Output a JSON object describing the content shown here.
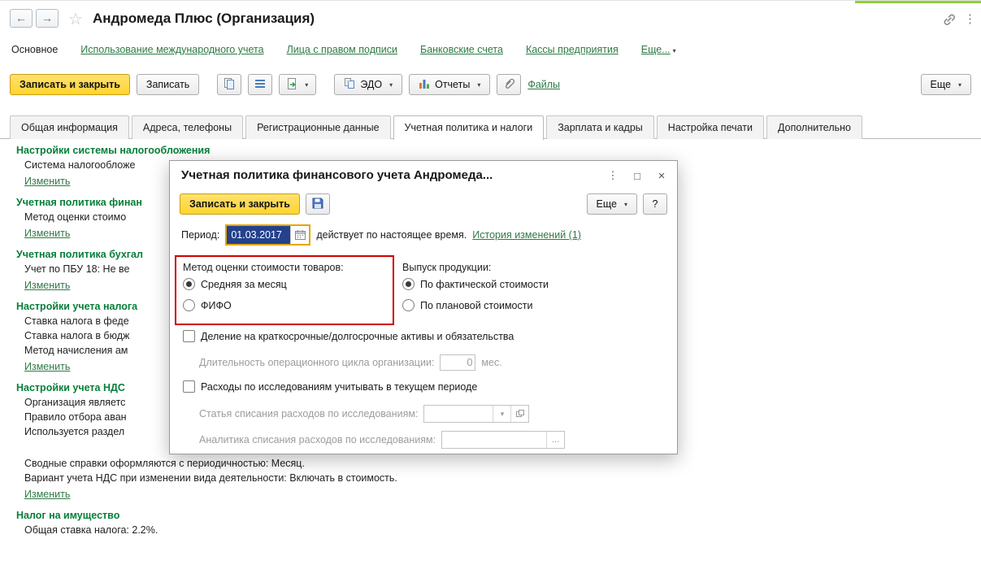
{
  "colors": {
    "primary_button": "#ffd42e",
    "section_heading": "#067e39",
    "link": "#2f7a44",
    "annotation": "#cc0000",
    "selection": "#24418c"
  },
  "icons": {
    "back": "←",
    "forward": "→",
    "star": "☆",
    "caret_down": "▾",
    "menu_dots": "⋮",
    "maximize": "□",
    "close": "×",
    "help": "?",
    "ellipsis": "..."
  },
  "header": {
    "title": "Андромеда Плюс (Организация)"
  },
  "nav": {
    "current": "Основное",
    "links": [
      "Использование международного учета",
      "Лица с правом подписи",
      "Банковские счета",
      "Кассы предприятия"
    ],
    "more": "Еще..."
  },
  "toolbar": {
    "save_close": "Записать и закрыть",
    "save": "Записать",
    "edo": "ЭДО",
    "reports": "Отчеты",
    "files": "Файлы",
    "more": "Еще"
  },
  "tabs": {
    "active": "Учетная политика и налоги",
    "items": [
      "Общая информация",
      "Адреса, телефоны",
      "Регистрационные данные",
      "Учетная политика и налоги",
      "Зарплата и кадры",
      "Настройка печати",
      "Дополнительно"
    ]
  },
  "content": {
    "sections": [
      {
        "heading": "Настройки системы налогообложения",
        "lines": [
          "Система налогообложе"
        ],
        "link": "Изменить"
      },
      {
        "heading": "Учетная политика финан",
        "lines": [
          "Метод оценки стоимо"
        ],
        "link": "Изменить"
      },
      {
        "heading": "Учетная политика бухгал",
        "lines": [
          "Учет по ПБУ 18: Не ве"
        ],
        "link": "Изменить"
      },
      {
        "heading": "Настройки учета налога",
        "lines": [
          "Ставка налога в феде",
          "Ставка налога в бюдж",
          "Метод начисления ам"
        ],
        "link": "Изменить"
      },
      {
        "heading": "Настройки учета НДС",
        "lines": [
          "Организация являетс",
          "Правило отбора аван",
          "Используется раздел"
        ],
        "lines_full": [
          "Сводные справки оформляются с периодичностью: Месяц.",
          "Вариант учета НДС при изменении вида деятельности: Включать в стоимость."
        ],
        "link": "Изменить"
      },
      {
        "heading": "Налог на имущество",
        "lines": [
          "Общая ставка налога: 2.2%."
        ]
      }
    ]
  },
  "dialog": {
    "title": "Учетная политика финансового учета Андромеда...",
    "save_close": "Записать и закрыть",
    "more": "Еще",
    "period_label": "Период:",
    "period_value": "01.03.2017",
    "validity": "действует по настоящее время.",
    "history_link": "История изменений (1)",
    "valuation_group": {
      "label": "Метод оценки стоимости товаров:",
      "options": [
        {
          "label": "Средняя за месяц",
          "checked": true
        },
        {
          "label": "ФИФО",
          "checked": false
        }
      ]
    },
    "output_group": {
      "label": "Выпуск продукции:",
      "options": [
        {
          "label": "По фактической стоимости",
          "checked": true
        },
        {
          "label": "По плановой стоимости",
          "checked": false
        }
      ]
    },
    "checkbox_division": "Деление на краткосрочные/долгосрочные активы и обязательства",
    "checkbox_division_checked": false,
    "cycle_label": "Длительность операционного цикла организации:",
    "cycle_value": "0",
    "cycle_unit": "мес.",
    "checkbox_research": "Расходы по исследованиям учитывать в текущем периоде",
    "checkbox_research_checked": false,
    "research_expense_label": "Статья списания расходов по исследованиям:",
    "research_analytics_label": "Аналитика списания расходов по исследованиям:"
  }
}
